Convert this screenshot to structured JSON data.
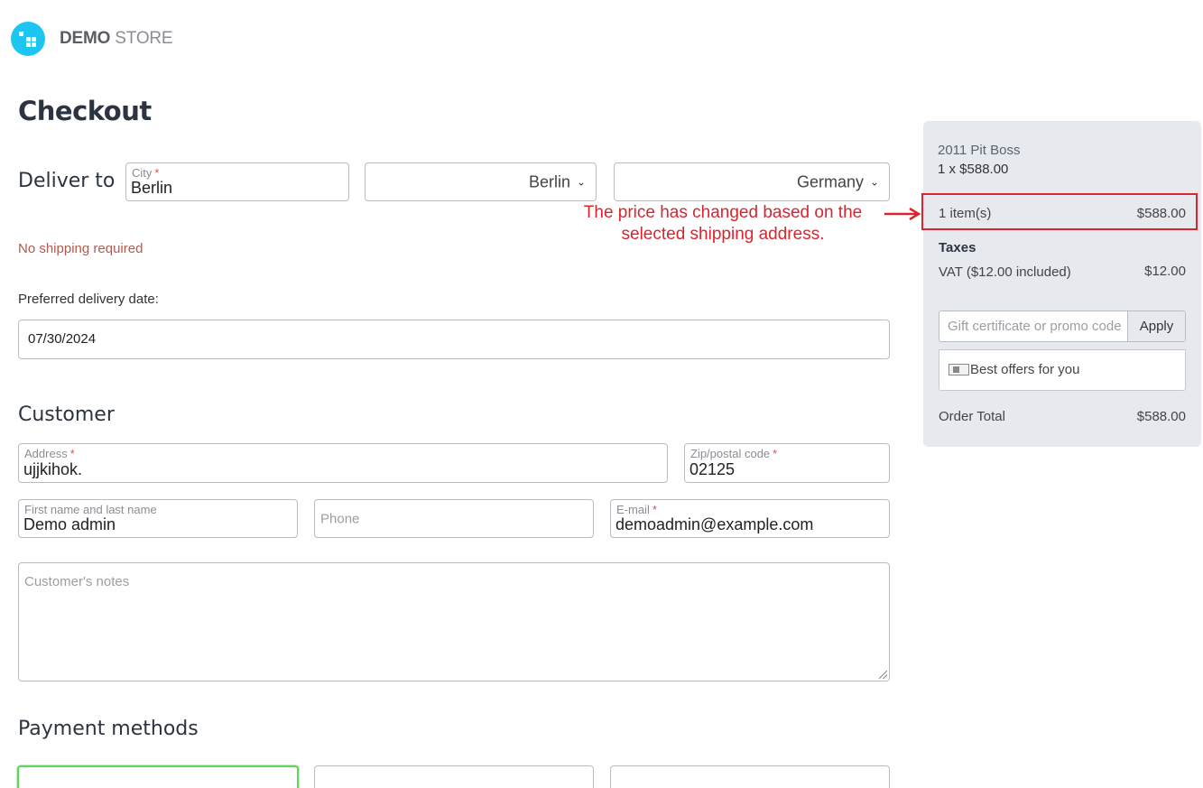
{
  "header": {
    "logo_bold": "DEMO",
    "logo_light": "STORE"
  },
  "page": {
    "title": "Checkout"
  },
  "delivery": {
    "label": "Deliver to",
    "city": {
      "label": "City",
      "required": "*",
      "value": "Berlin"
    },
    "city_select": {
      "value": "Berlin"
    },
    "country_select": {
      "value": "Germany"
    },
    "shipping_note": "No shipping required",
    "date_label": "Preferred delivery date:",
    "date_value": "07/30/2024"
  },
  "customer": {
    "heading": "Customer",
    "address": {
      "label": "Address",
      "required": "*",
      "value": "ujjkihok."
    },
    "zip": {
      "label": "Zip/postal code",
      "required": "*",
      "value": "02125"
    },
    "name": {
      "label": "First name and last name",
      "value": "Demo admin"
    },
    "phone": {
      "placeholder": "Phone"
    },
    "email": {
      "label": "E-mail",
      "required": "*",
      "value": "demoadmin@example.com"
    },
    "notes": {
      "placeholder": "Customer's notes"
    }
  },
  "payment": {
    "heading": "Payment methods"
  },
  "annotation": {
    "line1": "The price has changed based on the",
    "line2": "selected shipping address."
  },
  "summary": {
    "product": "2011 Pit Boss",
    "qty_line": "1 x $588.00",
    "items_label": "1 item(s)",
    "items_value": "$588.00",
    "taxes_heading": "Taxes",
    "vat_label": "VAT ($12.00 included)",
    "vat_value": "$12.00",
    "promo_placeholder": "Gift certificate or promo code",
    "apply_label": "Apply",
    "offers_label": "Best offers for you",
    "total_label": "Order Total",
    "total_value": "$588.00"
  },
  "colors": {
    "brand": "#1dc5f1",
    "annotation": "#d8252e",
    "summary_bg": "#e6e9ed",
    "selected_border": "#5cd65c"
  }
}
